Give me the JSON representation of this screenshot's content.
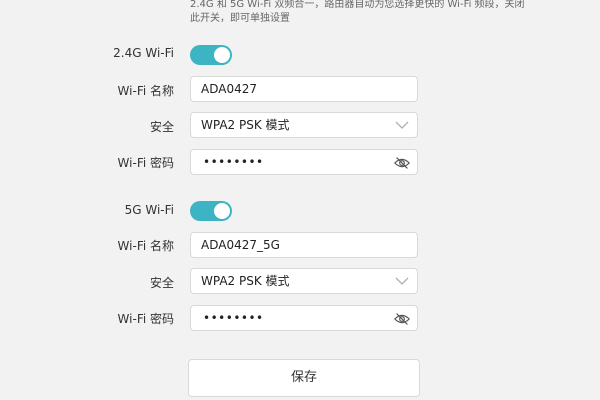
{
  "note": "2.4G 和 5G Wi-Fi 双频合一，路由器自动为您选择更快的 Wi-Fi 频段，关闭此开关，即可单独设置",
  "band_24": {
    "toggle_label": "2.4G Wi-Fi",
    "toggle_on": true,
    "name_label": "Wi-Fi 名称",
    "name_value": "ADA0427",
    "security_label": "安全",
    "security_value": "WPA2 PSK 模式",
    "password_label": "Wi-Fi 密码",
    "password_value": "••••••••"
  },
  "band_5": {
    "toggle_label": "5G Wi-Fi",
    "toggle_on": true,
    "name_label": "Wi-Fi 名称",
    "name_value": "ADA0427_5G",
    "security_label": "安全",
    "security_value": "WPA2 PSK 模式",
    "password_label": "Wi-Fi 密码",
    "password_value": "••••••••"
  },
  "save_label": "保存",
  "colors": {
    "accent": "#3db4c3",
    "background": "#f2f2f2",
    "border": "#d9d9d9"
  },
  "icons": {
    "select_arrow": "chevron-down-icon",
    "password_visibility": "eye-hidden-icon"
  }
}
